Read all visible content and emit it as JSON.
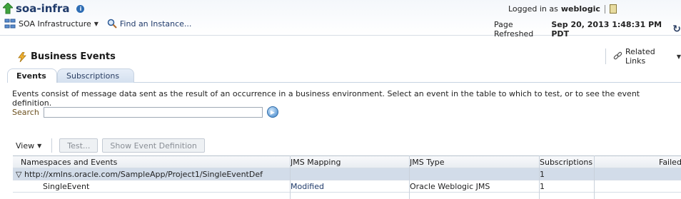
{
  "header": {
    "app_title": "soa-infra",
    "login_prefix": "Logged in as",
    "username": "weblogic",
    "nav_menu": "SOA Infrastructure",
    "find_instance": "Find an Instance...",
    "refresh_prefix": "Page Refreshed",
    "refresh_time": "Sep 20, 2013 1:48:31 PM PDT"
  },
  "section": {
    "title": "Business Events",
    "related_links": "Related Links"
  },
  "tabs": [
    {
      "label": "Events",
      "selected": true
    },
    {
      "label": "Subscriptions",
      "selected": false
    }
  ],
  "description": "Events consist of message data sent as the result of an occurrence in a business environment. Select an event in the table to which to test, or to see the event definition.",
  "search": {
    "label": "Search",
    "value": ""
  },
  "toolbar": {
    "view_label": "View",
    "test_label": "Test...",
    "show_def_label": "Show Event Definition"
  },
  "table": {
    "columns": [
      "Namespaces and Events",
      "JMS Mapping",
      "JMS Type",
      "Subscriptions",
      "Failed"
    ],
    "rows": [
      {
        "name": "http://xmlns.oracle.com/SampleApp/Project1/SingleEventDef",
        "jms_mapping": "",
        "jms_type": "",
        "subscriptions": "1",
        "failed": ""
      },
      {
        "name": "SingleEvent",
        "jms_mapping": "Modified",
        "jms_type": "Oracle Weblogic JMS",
        "subscriptions": "1",
        "failed": ""
      }
    ]
  },
  "colors": {
    "brand": "#1f3a6a",
    "selected_row": "#d2dce9"
  }
}
